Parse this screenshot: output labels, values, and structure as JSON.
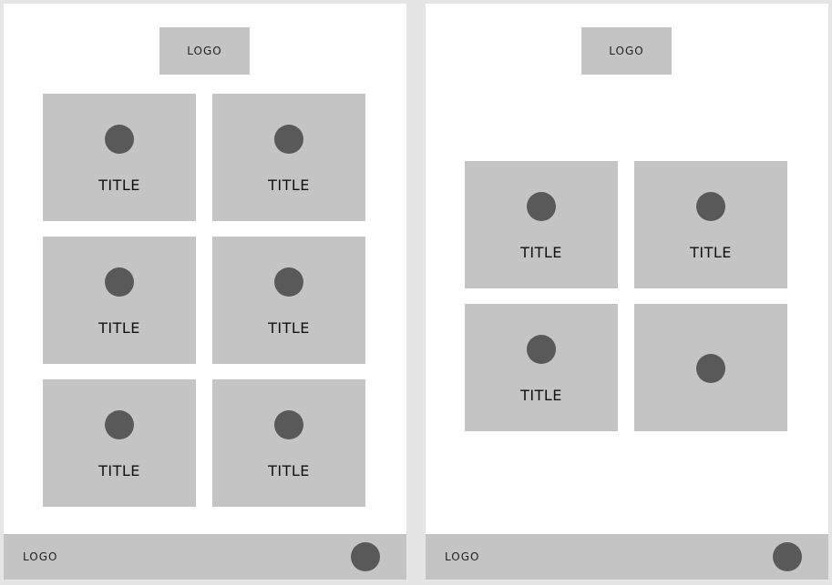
{
  "left_screen": {
    "logo": "LOGO",
    "cards": [
      {
        "title": "TITLE"
      },
      {
        "title": "TITLE"
      },
      {
        "title": "TITLE"
      },
      {
        "title": "TITLE"
      },
      {
        "title": "TITLE"
      },
      {
        "title": "TITLE"
      }
    ],
    "footer": {
      "logo": "LOGO"
    }
  },
  "right_screen": {
    "logo": "LOGO",
    "cards": [
      {
        "title": "TITLE"
      },
      {
        "title": "TITLE"
      },
      {
        "title": "TITLE"
      },
      {
        "title": ""
      }
    ],
    "footer": {
      "logo": "LOGO"
    }
  },
  "colors": {
    "background": "#e5e5e5",
    "screen": "#ffffff",
    "placeholder": "#c4c4c4",
    "icon": "#595959"
  }
}
